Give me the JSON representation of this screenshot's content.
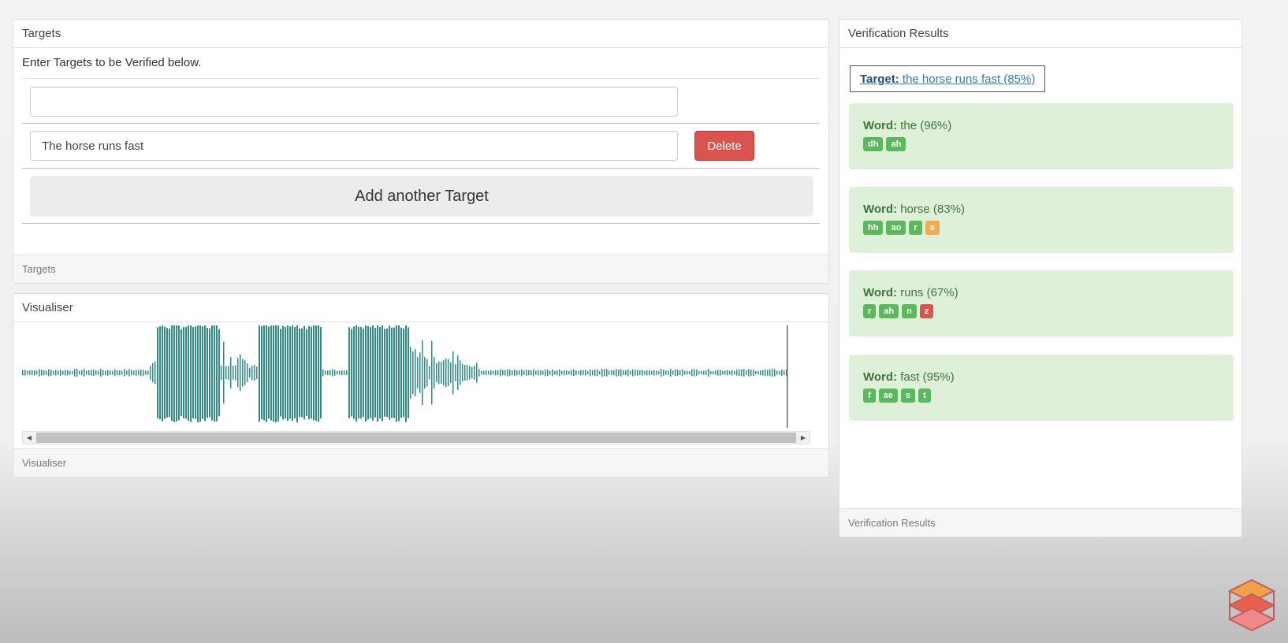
{
  "targets": {
    "title": "Targets",
    "intro": "Enter Targets to be Verified below.",
    "inputs": [
      {
        "value": "",
        "placeholder": ""
      },
      {
        "value": "The horse runs fast",
        "placeholder": ""
      }
    ],
    "delete_label": "Delete",
    "add_label": "Add another Target",
    "footer": "Targets"
  },
  "visualiser": {
    "title": "Visualiser",
    "footer": "Visualiser",
    "waveform_color": "#2e8b86"
  },
  "verification": {
    "title": "Verification Results",
    "target_label": "Target:",
    "target_text": "the horse runs fast (85%)",
    "word_label": "Word:",
    "words": [
      {
        "word": "the",
        "score": "(96%)",
        "phonemes": [
          {
            "p": "dh",
            "status": "good"
          },
          {
            "p": "ah",
            "status": "good"
          }
        ]
      },
      {
        "word": "horse",
        "score": "(83%)",
        "phonemes": [
          {
            "p": "hh",
            "status": "good"
          },
          {
            "p": "ao",
            "status": "good"
          },
          {
            "p": "r",
            "status": "good"
          },
          {
            "p": "s",
            "status": "warn"
          }
        ]
      },
      {
        "word": "runs",
        "score": "(67%)",
        "phonemes": [
          {
            "p": "r",
            "status": "good"
          },
          {
            "p": "ah",
            "status": "good"
          },
          {
            "p": "n",
            "status": "good"
          },
          {
            "p": "z",
            "status": "bad"
          }
        ]
      },
      {
        "word": "fast",
        "score": "(95%)",
        "phonemes": [
          {
            "p": "f",
            "status": "good"
          },
          {
            "p": "ae",
            "status": "good"
          },
          {
            "p": "s",
            "status": "good"
          },
          {
            "p": "t",
            "status": "good"
          }
        ]
      }
    ],
    "footer": "Verification Results"
  },
  "colors": {
    "good": "#5cb85c",
    "warn": "#f0ad4e",
    "bad": "#d9534f",
    "card_bg": "#dff0d8",
    "danger": "#d9534f"
  }
}
